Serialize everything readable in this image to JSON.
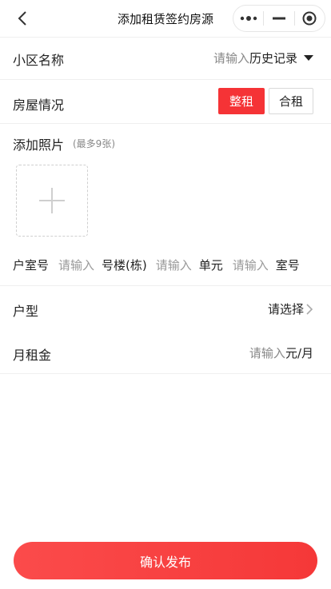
{
  "nav": {
    "title": "添加租赁签约房源",
    "back_icon": "chevron-left-icon",
    "more_icon": "more-dots-icon",
    "minimize_icon": "minus-icon",
    "target_icon": "record-icon"
  },
  "form": {
    "community": {
      "label": "小区名称",
      "placeholder": "请输入",
      "history_label": "历史记录"
    },
    "house": {
      "label": "房屋情况",
      "options": [
        "整租",
        "合租"
      ],
      "selected": "整租"
    },
    "photos": {
      "label": "添加照片",
      "hint": "(最多9张)"
    },
    "room": {
      "label": "户室号",
      "building_placeholder": "请输入",
      "building_unit": "号楼(栋)",
      "unit_placeholder": "请输入",
      "unit_unit": "单元",
      "room_placeholder": "请输入",
      "room_unit": "室号"
    },
    "layout": {
      "label": "户型",
      "placeholder": "请选择"
    },
    "rent": {
      "label": "月租金",
      "placeholder": "请输入",
      "unit": "元/月"
    }
  },
  "submit_label": "确认发布",
  "colors": {
    "accent": "#f53336",
    "placeholder": "#888888",
    "divider": "#efefef"
  }
}
